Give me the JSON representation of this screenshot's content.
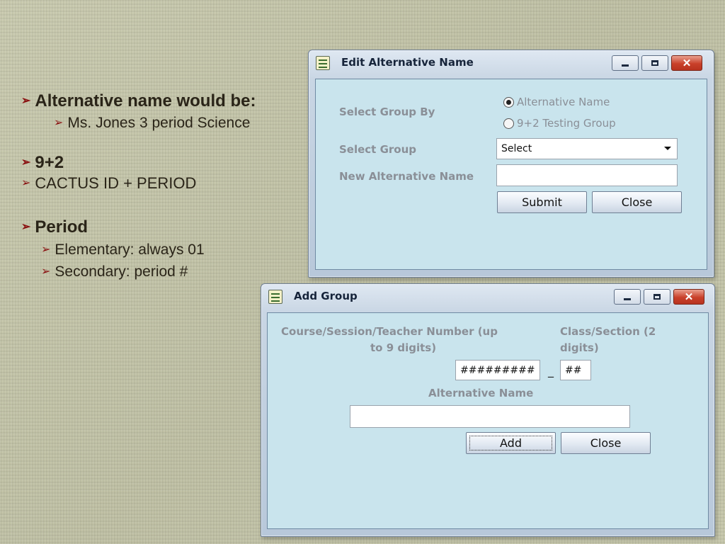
{
  "slide": {
    "bullets": [
      {
        "text": "Alternative name would be:",
        "level": 1,
        "bold": true
      },
      {
        "text": "Ms. Jones 3 period Science",
        "level": 2,
        "bold": false
      },
      {
        "text": "9+2",
        "level": 1,
        "bold": true
      },
      {
        "text": "CACTUS ID +  PERIOD",
        "level": 1,
        "bold": false
      },
      {
        "text": "Period",
        "level": 1,
        "bold": true
      },
      {
        "text": "Elementary: always 01",
        "level": 2,
        "bold": false
      },
      {
        "text": "Secondary: period #",
        "level": 2,
        "bold": false
      }
    ]
  },
  "edit_dialog": {
    "title": "Edit Alternative Name",
    "select_group_by_label": "Select Group By",
    "radio_alternative_name": "Alternative Name",
    "radio_testing_group": "9+2 Testing Group",
    "selected_radio": "Alternative Name",
    "select_group_label": "Select Group",
    "select_group_value": "Select",
    "new_alt_name_label": "New Alternative Name",
    "new_alt_name_value": "",
    "submit_label": "Submit",
    "close_label": "Close"
  },
  "add_dialog": {
    "title": "Add Group",
    "course_label_line1": "Course/Session/Teacher Number (up",
    "course_label_line2": "to 9 digits)",
    "class_label_line1": "Class/Section (2",
    "class_label_line2": "digits)",
    "course_value": "#########",
    "separator": "_",
    "class_value": "##",
    "alt_name_label": "Alternative Name",
    "alt_name_value": "",
    "add_label": "Add",
    "close_label": "Close"
  },
  "colors": {
    "bullet_arrow": "#8a1010",
    "dialog_content": "#c9e4ed",
    "close_button": "#c9402a"
  }
}
